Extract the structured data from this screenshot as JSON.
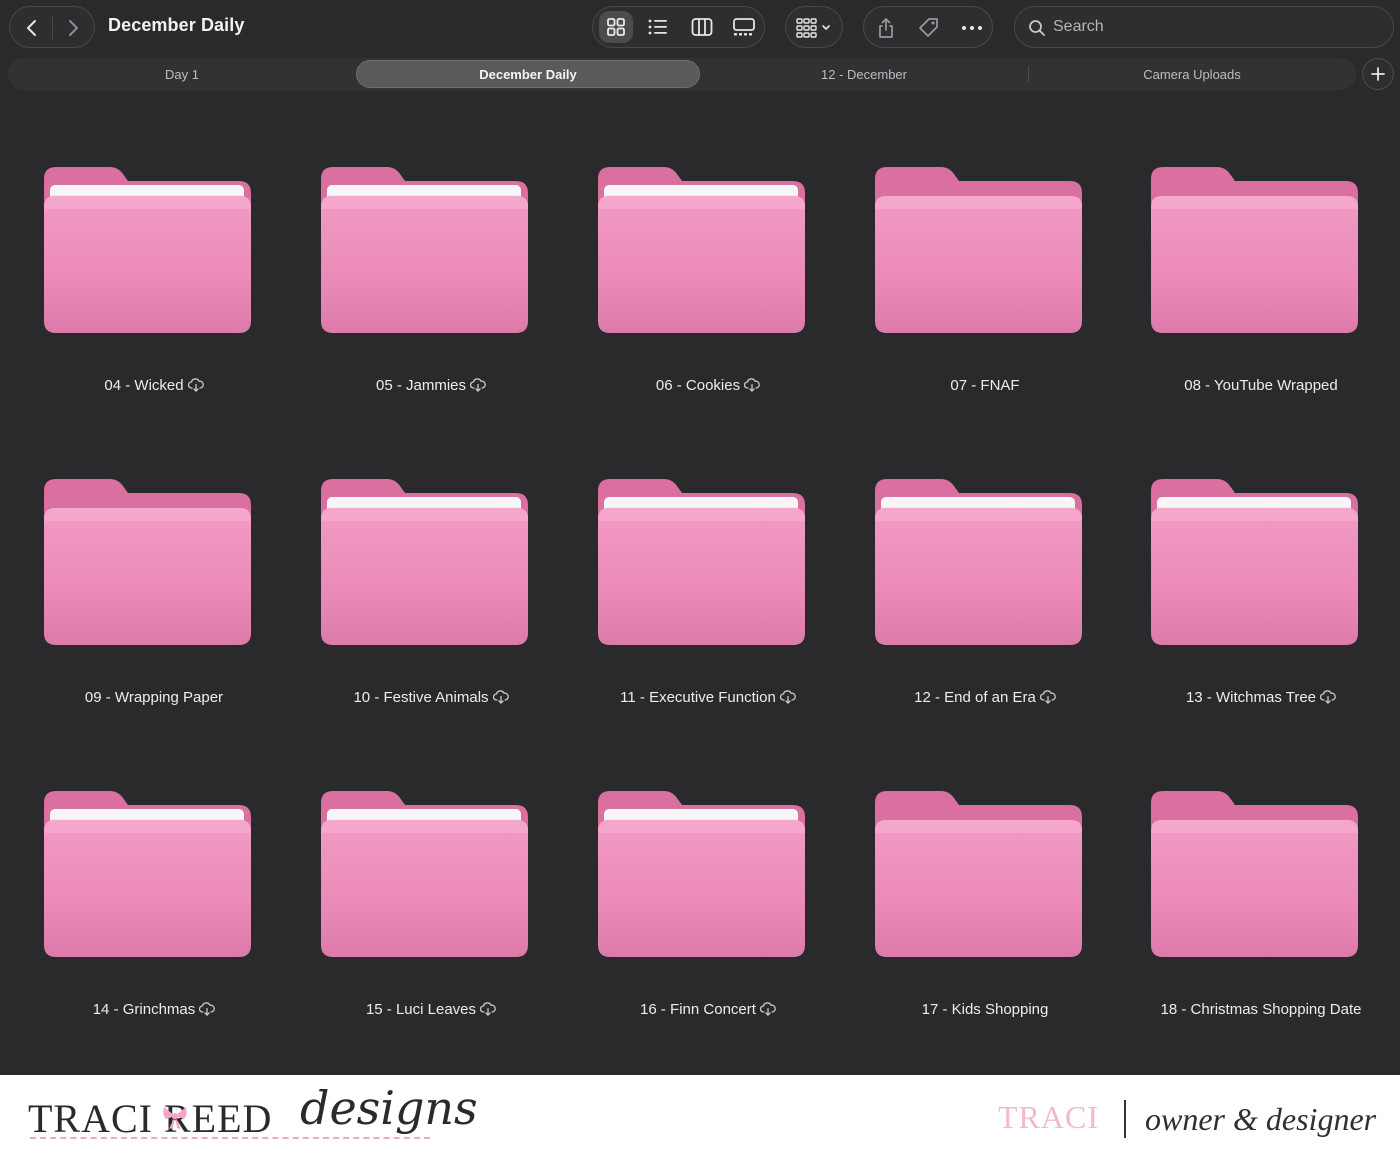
{
  "window": {
    "title": "December Daily"
  },
  "search": {
    "placeholder": "Search"
  },
  "tabs": [
    {
      "label": "Day 1",
      "active": false
    },
    {
      "label": "December Daily",
      "active": true
    },
    {
      "label": "12 - December",
      "active": false
    },
    {
      "label": "Camera Uploads",
      "active": false
    }
  ],
  "folders": [
    {
      "name": "04 - Wicked",
      "cloud": true,
      "has_paper": true
    },
    {
      "name": "05 - Jammies",
      "cloud": true,
      "has_paper": true
    },
    {
      "name": "06 - Cookies",
      "cloud": true,
      "has_paper": true
    },
    {
      "name": "07 - FNAF",
      "cloud": false,
      "has_paper": false
    },
    {
      "name": "08 - YouTube Wrapped",
      "cloud": false,
      "has_paper": false
    },
    {
      "name": "09 - Wrapping Paper",
      "cloud": false,
      "has_paper": false
    },
    {
      "name": "10 - Festive Animals",
      "cloud": true,
      "has_paper": true
    },
    {
      "name": "11 - Executive Function",
      "cloud": true,
      "has_paper": true
    },
    {
      "name": "12 - End of an Era",
      "cloud": true,
      "has_paper": true
    },
    {
      "name": "13 - Witchmas Tree",
      "cloud": true,
      "has_paper": true
    },
    {
      "name": "14 - Grinchmas",
      "cloud": true,
      "has_paper": true
    },
    {
      "name": "15 - Luci Leaves",
      "cloud": true,
      "has_paper": true
    },
    {
      "name": "16 - Finn Concert",
      "cloud": true,
      "has_paper": true
    },
    {
      "name": "17 - Kids Shopping",
      "cloud": false,
      "has_paper": false
    },
    {
      "name": "18 - Christmas Shopping Date",
      "cloud": false,
      "has_paper": false
    }
  ],
  "colors": {
    "folder_pink": "#ec8ab8",
    "folder_back": "#d9709f",
    "background": "#2a2a2c",
    "brand_pink": "#f3b8d1"
  },
  "branding": {
    "name": "TRACI REED",
    "script": "designs",
    "owner_first": "TRACI",
    "owner_role": "owner & designer"
  },
  "icons": [
    "back-icon",
    "forward-icon",
    "icon-view-icon",
    "list-view-icon",
    "column-view-icon",
    "gallery-view-icon",
    "group-icon",
    "share-icon",
    "tag-icon",
    "more-icon",
    "search-icon",
    "plus-icon",
    "cloud-download-icon",
    "folder-icon"
  ]
}
